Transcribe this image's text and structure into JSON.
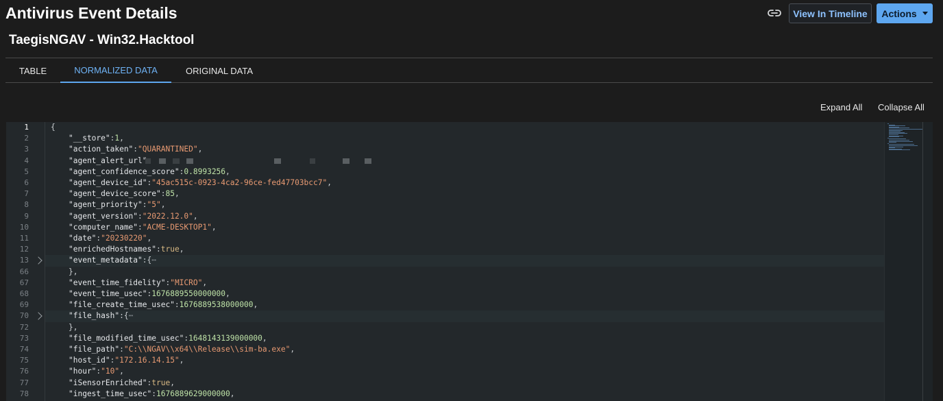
{
  "header": {
    "title": "Antivirus Event Details",
    "link_icon": "link-icon",
    "view_timeline_label": "View In Timeline",
    "actions_label": "Actions"
  },
  "subtitle": "TaegisNGAV - Win32.Hacktool",
  "tabs": [
    {
      "label": "TABLE",
      "active": false
    },
    {
      "label": "NORMALIZED DATA",
      "active": true
    },
    {
      "label": "ORIGINAL DATA",
      "active": false
    }
  ],
  "toolbar": {
    "expand_all_label": "Expand All",
    "collapse_all_label": "Collapse All"
  },
  "editor": {
    "lines": [
      {
        "n": "1",
        "text": "{"
      },
      {
        "n": "2",
        "key": "\"__store\"",
        "value": "1",
        "vtype": "num"
      },
      {
        "n": "3",
        "key": "\"action_taken\"",
        "value": "\"QUARANTINED\"",
        "vtype": "str"
      },
      {
        "n": "4",
        "key": "\"agent_alert_url\"",
        "value": "",
        "vtype": "redacted"
      },
      {
        "n": "5",
        "key": "\"agent_confidence_score\"",
        "value": "0.8993256",
        "vtype": "num"
      },
      {
        "n": "6",
        "key": "\"agent_device_id\"",
        "value": "\"45ac515c-0923-4ca2-96ce-fed47703bcc7\"",
        "vtype": "str"
      },
      {
        "n": "7",
        "key": "\"agent_device_score\"",
        "value": "85",
        "vtype": "num"
      },
      {
        "n": "8",
        "key": "\"agent_priority\"",
        "value": "\"5\"",
        "vtype": "str"
      },
      {
        "n": "9",
        "key": "\"agent_version\"",
        "value": "\"2022.12.0\"",
        "vtype": "str"
      },
      {
        "n": "10",
        "key": "\"computer_name\"",
        "value": "\"ACME-DESKTOP1\"",
        "vtype": "str"
      },
      {
        "n": "11",
        "key": "\"date\"",
        "value": "\"20230220\"",
        "vtype": "str"
      },
      {
        "n": "12",
        "key": "\"enrichedHostnames\"",
        "value": "true",
        "vtype": "bool"
      },
      {
        "n": "13",
        "key": "\"event_metadata\"",
        "value": "{",
        "vtype": "fold"
      },
      {
        "n": "66",
        "text": "},"
      },
      {
        "n": "67",
        "key": "\"event_time_fidelity\"",
        "value": "\"MICRO\"",
        "vtype": "str"
      },
      {
        "n": "68",
        "key": "\"event_time_usec\"",
        "value": "1676889550000000",
        "vtype": "num"
      },
      {
        "n": "69",
        "key": "\"file_create_time_usec\"",
        "value": "1676889538000000",
        "vtype": "num"
      },
      {
        "n": "70",
        "key": "\"file_hash\"",
        "value": "{",
        "vtype": "fold"
      },
      {
        "n": "72",
        "text": "},"
      },
      {
        "n": "73",
        "key": "\"file_modified_time_usec\"",
        "value": "1648143139000000",
        "vtype": "num"
      },
      {
        "n": "74",
        "key": "\"file_path\"",
        "value": "\"C:\\\\NGAV\\\\x64\\\\Release\\\\sim-ba.exe\"",
        "vtype": "str"
      },
      {
        "n": "75",
        "key": "\"host_id\"",
        "value": "\"172.16.14.15\"",
        "vtype": "str"
      },
      {
        "n": "76",
        "key": "\"hour\"",
        "value": "\"10\"",
        "vtype": "str"
      },
      {
        "n": "77",
        "key": "\"iSensorEnriched\"",
        "value": "true",
        "vtype": "bool"
      },
      {
        "n": "78",
        "key": "\"ingest_time_usec\"",
        "value": "1676889629000000",
        "vtype": "num"
      }
    ]
  }
}
